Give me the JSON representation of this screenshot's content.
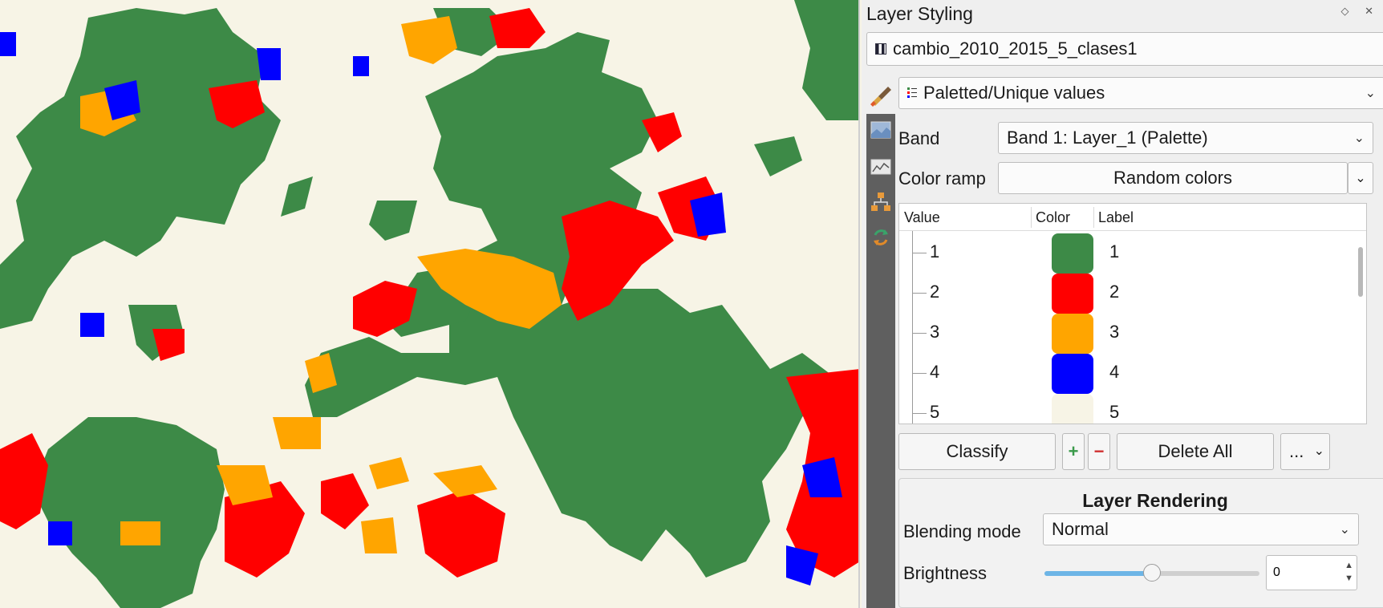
{
  "map": {
    "classes": [
      {
        "value": "1",
        "color": "#3d8a47"
      },
      {
        "value": "2",
        "color": "#ff0000"
      },
      {
        "value": "3",
        "color": "#ffa500"
      },
      {
        "value": "4",
        "color": "#0000ff"
      },
      {
        "value": "5",
        "color": "#f7f4e6"
      }
    ]
  },
  "dock": {
    "title": "Layer Styling",
    "controls": "◇ ✕",
    "layer_name": "cambio_2010_2015_5_clases1",
    "renderer": "Paletted/Unique values",
    "band_label": "Band",
    "band_value": "Band 1: Layer_1 (Palette)",
    "color_ramp_label": "Color ramp",
    "color_ramp_value": "Random colors",
    "table": {
      "headers": [
        "Value",
        "Color",
        "Label"
      ],
      "rows": [
        {
          "value": "1",
          "color": "#3d8a47",
          "label": "1"
        },
        {
          "value": "2",
          "color": "#ff0000",
          "label": "2"
        },
        {
          "value": "3",
          "color": "#ffa500",
          "label": "3"
        },
        {
          "value": "4",
          "color": "#0000ff",
          "label": "4"
        },
        {
          "value": "5",
          "color": "#f7f4e6",
          "label": "5"
        }
      ]
    },
    "buttons": {
      "classify": "Classify",
      "add": "+",
      "remove": "−",
      "delete_all": "Delete All",
      "more": "..."
    },
    "rendering": {
      "title": "Layer Rendering",
      "blending_label": "Blending mode",
      "blending_value": "Normal",
      "brightness_label": "Brightness",
      "brightness_value": "0",
      "brightness_level": 0.5
    }
  }
}
